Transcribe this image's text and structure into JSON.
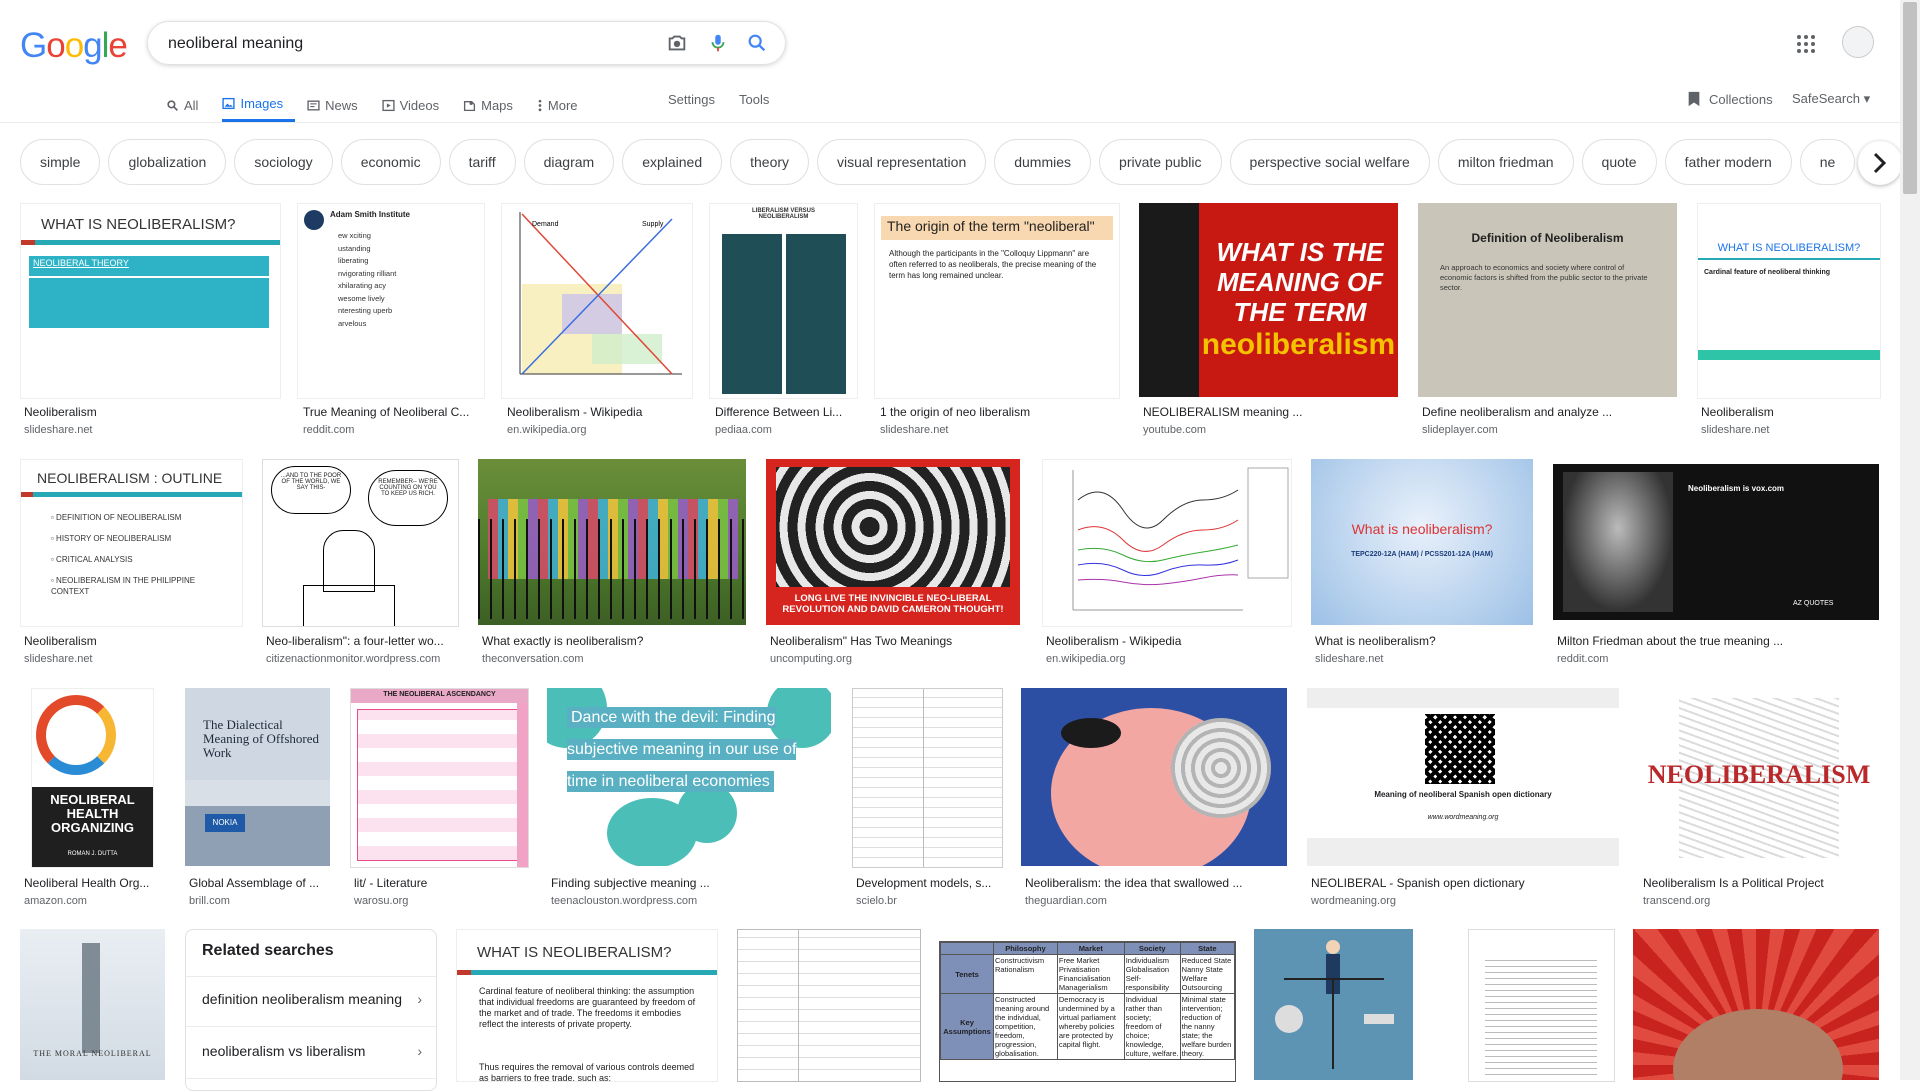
{
  "header": {
    "logo_letters": [
      {
        "ch": "G",
        "color": "#4285f4"
      },
      {
        "ch": "o",
        "color": "#ea4335"
      },
      {
        "ch": "o",
        "color": "#fbbc05"
      },
      {
        "ch": "g",
        "color": "#4285f4"
      },
      {
        "ch": "l",
        "color": "#34a853"
      },
      {
        "ch": "e",
        "color": "#ea4335"
      }
    ],
    "search_value": "neoliberal meaning"
  },
  "tabs": [
    {
      "label": "All",
      "icon": "search-icon"
    },
    {
      "label": "Images",
      "icon": "image-icon"
    },
    {
      "label": "News",
      "icon": "news-icon"
    },
    {
      "label": "Videos",
      "icon": "video-icon"
    },
    {
      "label": "Maps",
      "icon": "map-pin-icon"
    },
    {
      "label": "More",
      "icon": "more-vert-icon"
    }
  ],
  "tools": {
    "settings": "Settings",
    "tools": "Tools",
    "collections": "Collections",
    "safesearch": "SafeSearch"
  },
  "chips": [
    "simple",
    "globalization",
    "sociology",
    "economic",
    "tariff",
    "diagram",
    "explained",
    "theory",
    "visual representation",
    "dummies",
    "private public",
    "perspective social welfare",
    "milton friedman",
    "quote",
    "father modern",
    "ne"
  ],
  "row1": [
    {
      "caption": "Neoliberalism",
      "source": "slideshare.net",
      "title": "WHAT IS NEOLIBERALISM?",
      "sub": "NEOLIBERAL THEORY"
    },
    {
      "caption": "True Meaning of Neoliberal C...",
      "source": "reddit.com",
      "title": "Adam Smith Institute",
      "sub": "ew xciting ustanding liberating nvigorating rilliant xhilarating acy wesome lively nteresting uperb arvelous"
    },
    {
      "caption": "Neoliberalism - Wikipedia",
      "source": "en.wikipedia.org",
      "title": "Demand",
      "sub": "Supply"
    },
    {
      "caption": "Difference Between Li...",
      "source": "pediaa.com",
      "title": "LIBERALISM VERSUS NEOLIBERALISM",
      "sub": ""
    },
    {
      "caption": "1 the origin of neo liberalism",
      "source": "slideshare.net",
      "title": "The origin of the term \"neoliberal\"",
      "sub": "Although the participants in the \"Colloquy Lippmann\" are often referred to as neoliberals, the precise meaning of the term has long remained unclear."
    },
    {
      "caption": "NEOLIBERALISM meaning ...",
      "source": "youtube.com",
      "title": "WHAT IS THE MEANING OF THE TERM",
      "sub": "neoliberalism"
    },
    {
      "caption": "Define neoliberalism and analyze ...",
      "source": "slideplayer.com",
      "title": "Definition of Neoliberalism",
      "sub": "An approach to economics and society where control of economic factors is shifted from the public sector to the private sector."
    },
    {
      "caption": "Neoliberalism",
      "source": "slideshare.net",
      "title": "WHAT IS NEOLIBERALISM?",
      "sub": "Cardinal feature of neoliberal thinking"
    }
  ],
  "row2": [
    {
      "caption": "Neoliberalism",
      "source": "slideshare.net",
      "title": "NEOLIBERALISM : OUTLINE",
      "sub": "DEFINITION OF NEOLIBERALISM|HISTORY OF NEOLIBERALISM|CRITICAL ANALYSIS|NEOLIBERALISM IN THE PHILIPPINE CONTEXT"
    },
    {
      "caption": "Neo-liberalism\": a four-letter wo...",
      "source": "citizenactionmonitor.wordpress.com",
      "title": "...AND TO THE POOR OF THE WORLD, WE SAY THIS-",
      "sub": "REMEMBER-- WE'RE COUNTING ON YOU TO KEEP US RICH."
    },
    {
      "caption": "What exactly is neoliberalism?",
      "source": "theconversation.com",
      "title": "",
      "sub": ""
    },
    {
      "caption": "Neoliberalism\" Has Two Meanings",
      "source": "uncomputing.org",
      "title": "LONG LIVE THE INVINCIBLE NEO-LIBERAL REVOLUTION AND DAVID CAMERON THOUGHT!",
      "sub": ""
    },
    {
      "caption": "Neoliberalism - Wikipedia",
      "source": "en.wikipedia.org",
      "title": "",
      "sub": ""
    },
    {
      "caption": "What is neoliberalism?",
      "source": "slideshare.net",
      "title": "What is neoliberalism?",
      "sub": "TEPC220-12A (HAM) / PCSS201-12A (HAM)"
    },
    {
      "caption": "Milton Friedman about the true meaning ...",
      "source": "reddit.com",
      "title": "Neoliberalism is vox.com",
      "sub": "AZ QUOTES"
    }
  ],
  "row3": [
    {
      "caption": "Neoliberal Health Org...",
      "source": "amazon.com",
      "title": "NEOLIBERAL HEALTH ORGANIZING",
      "sub": "ROMAN J. DUTTA"
    },
    {
      "caption": "Global Assemblage of ...",
      "source": "brill.com",
      "title": "The Dialectical Meaning of Offshored Work",
      "sub": "NOKIA"
    },
    {
      "caption": "lit/ - Literature",
      "source": "warosu.org",
      "title": "THE NEOLIBERAL ASCENDANCY",
      "sub": ""
    },
    {
      "caption": "Finding subjective meaning ...",
      "source": "teenaclouston.wordpress.com",
      "title": "Dance with the devil: Finding subjective meaning in our use of time in neoliberal economies",
      "sub": ""
    },
    {
      "caption": "Development models, s...",
      "source": "scielo.br",
      "title": "",
      "sub": ""
    },
    {
      "caption": "Neoliberalism: the idea that swallowed ...",
      "source": "theguardian.com",
      "title": "",
      "sub": ""
    },
    {
      "caption": "NEOLIBERAL - Spanish open dictionary",
      "source": "wordmeaning.org",
      "title": "Meaning of neoliberal Spanish open dictionary",
      "sub": "www.wordmeaning.org"
    },
    {
      "caption": "Neoliberalism Is a Political Project",
      "source": "transcend.org",
      "title": "NEOLIBERALISM",
      "sub": ""
    }
  ],
  "row4": {
    "book_title": "THE MORAL NEOLIBERAL",
    "related_title": "Related searches",
    "related": [
      "definition neoliberalism meaning",
      "neoliberalism vs liberalism"
    ],
    "slide_title": "WHAT IS NEOLIBERALISM?",
    "slide_text": "Cardinal feature of neoliberal thinking: the assumption that individual freedoms are guaranteed by freedom of the market and of trade. The freedoms it embodies reflect the interests of private property.",
    "slide_text2": "Thus requires the removal of various controls deemed as barriers to free trade, such as:",
    "table_headers": [
      "Philosophy",
      "Market",
      "Society",
      "State"
    ],
    "table_rows": [
      [
        "Tenets",
        "Constructivism Rationalism",
        "Free Market Privatisation Financialisation Managerialism",
        "Individualism Globalisation Self-responsibility",
        "Reduced State Nanny State Welfare Outsourcing"
      ],
      [
        "Key Assumptions",
        "Constructed meaning around the individual, competition, freedom, progression, globalisation.",
        "Democracy is undermined by a virtual parliament whereby policies are protected by capital flight.",
        "Individual rather than society; freedom of choice; knowledge, culture, welfare.",
        "Minimal state intervention; reduction of the nanny state; the welfare burden theory."
      ]
    ]
  }
}
